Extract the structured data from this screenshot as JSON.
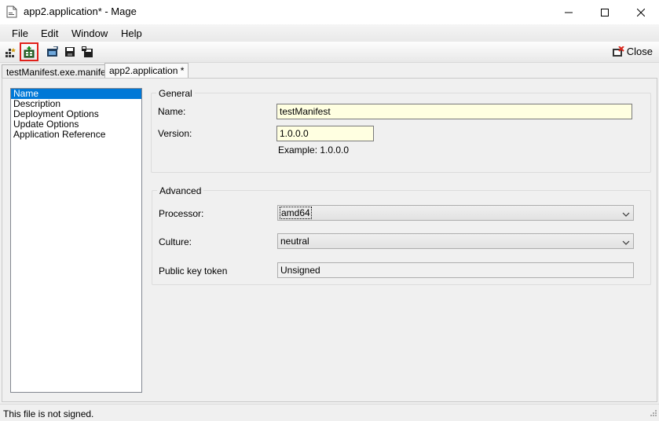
{
  "window": {
    "title": "app2.application* - Mage"
  },
  "menu": {
    "items": [
      "File",
      "Edit",
      "Window",
      "Help"
    ]
  },
  "toolbar": {
    "buttons": [
      "new-manifest-icon",
      "new-application-manifest-icon",
      "open-icon",
      "save-icon",
      "save-as-icon"
    ],
    "close_label": "Close"
  },
  "tabs": [
    {
      "label": "testManifest.exe.manifest",
      "active": false
    },
    {
      "label": "app2.application *",
      "active": true
    }
  ],
  "nav": {
    "items": [
      "Name",
      "Description",
      "Deployment Options",
      "Update Options",
      "Application Reference"
    ],
    "selected": "Name"
  },
  "general": {
    "legend": "General",
    "name_label": "Name:",
    "name_value": "testManifest",
    "version_label": "Version:",
    "version_value": "1.0.0.0",
    "example": "Example: 1.0.0.0"
  },
  "advanced": {
    "legend": "Advanced",
    "processor_label": "Processor:",
    "processor_value": "amd64",
    "culture_label": "Culture:",
    "culture_value": "neutral",
    "pkt_label": "Public key token",
    "pkt_value": "Unsigned"
  },
  "status": {
    "text": "This file is not signed."
  },
  "colors": {
    "selection": "#0078d7",
    "highlight": "#e0201a",
    "field_yellow": "#ffffe1"
  }
}
